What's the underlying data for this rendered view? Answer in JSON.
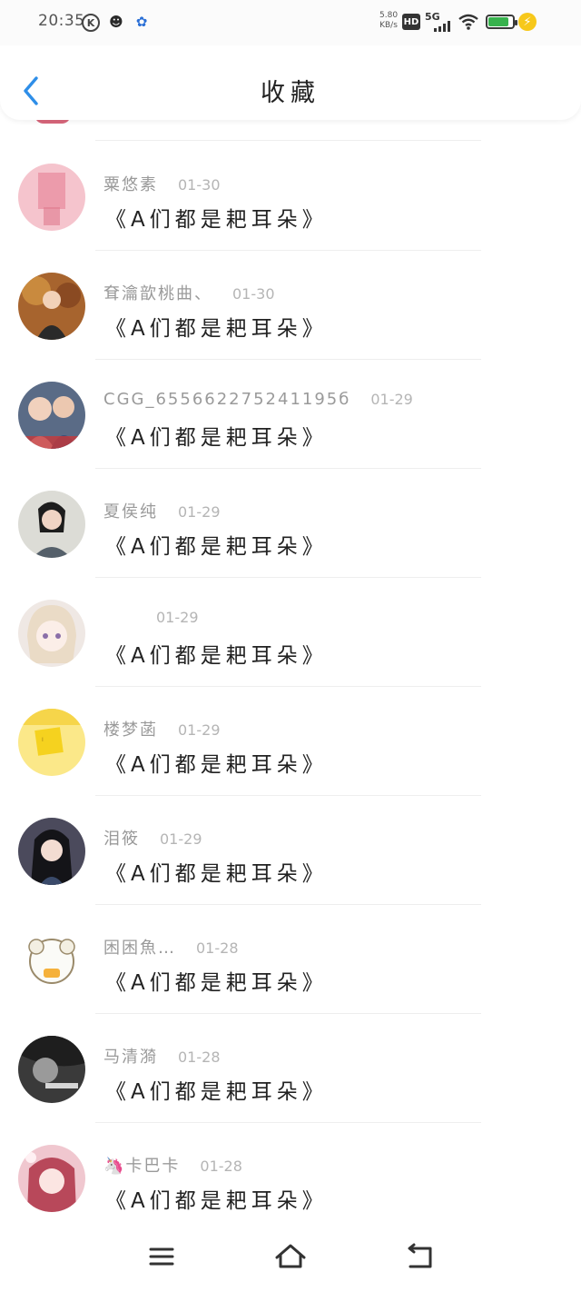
{
  "status_bar": {
    "time": "20:35",
    "speed_value": "5.80",
    "speed_unit": "KB/s",
    "hd": "HD",
    "network": "5G"
  },
  "header": {
    "title": "收藏"
  },
  "items": [
    {
      "name": "粟悠素",
      "date": "01-30",
      "content": "《A们都是耙耳朵》"
    },
    {
      "name": "耷瀹歆桃曲、",
      "date": "01-30",
      "content": "《A们都是耙耳朵》"
    },
    {
      "name": "CGG_655662275241195б",
      "date": "01-29",
      "content": "《A们都是耙耳朵》"
    },
    {
      "name": "夏侯纯",
      "date": "01-29",
      "content": "《A们都是耙耳朵》"
    },
    {
      "name": "",
      "date": "01-29",
      "content": "《A们都是耙耳朵》"
    },
    {
      "name": "楼梦菡",
      "date": "01-29",
      "content": "《A们都是耙耳朵》"
    },
    {
      "name": "泪筱",
      "date": "01-29",
      "content": "《A们都是耙耳朵》"
    },
    {
      "name": "困困魚…",
      "date": "01-28",
      "content": "《A们都是耙耳朵》"
    },
    {
      "name": "马清漪",
      "date": "01-28",
      "content": "《A们都是耙耳朵》"
    },
    {
      "name": "🦄卡巴卡",
      "date": "01-28",
      "content": "《A们都是耙耳朵》"
    }
  ],
  "colors": {
    "accent": "#2e8ee8"
  }
}
